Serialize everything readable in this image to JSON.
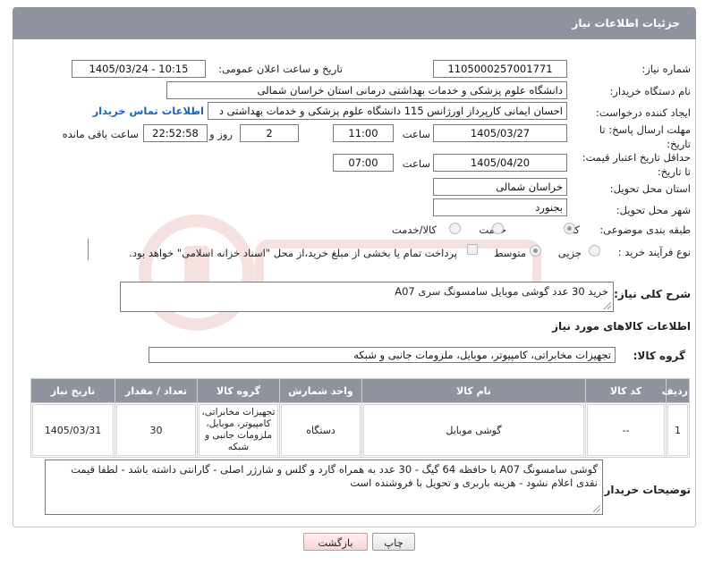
{
  "header": {
    "title": "جزئیات اطلاعات نیاز"
  },
  "form": {
    "need_number": {
      "label": "شماره نیاز:",
      "value": "1105000257001771"
    },
    "announce": {
      "label": "تاریخ و ساعت اعلان عمومی:",
      "value": "1405/03/24 - 10:15"
    },
    "buyer_org": {
      "label": "نام دستگاه خریدار:",
      "value": "دانشگاه علوم پزشکی و خدمات بهداشتی درمانی استان خراسان شمالی"
    },
    "requester": {
      "label": "ایجاد کننده درخواست:",
      "value": "احسان ایمانی کارپرداز اورژانس 115 دانشگاه علوم پزشکی و خدمات بهداشتی د",
      "contact_link": "اطلاعات تماس خریدار"
    },
    "deadline": {
      "label_line1": "مهلت ارسال پاسخ: تا",
      "label_line2": "تاریخ:",
      "date": "1405/03/27",
      "time_label": "ساعت",
      "time": "11:00",
      "days": "2",
      "days_label": "روز و",
      "remaining": "22:52:58",
      "remaining_label": "ساعت باقی مانده"
    },
    "price_validity": {
      "label_line1": "حداقل تاریخ اعتبار قیمت:",
      "label_line2": "تا تاریخ:",
      "date": "1405/04/20",
      "time_label": "ساعت",
      "time": "07:00"
    },
    "delivery_province": {
      "label": "استان محل تحویل:",
      "value": "خراسان شمالی"
    },
    "delivery_city": {
      "label": "شهر محل تحویل:",
      "value": "بجنورد"
    },
    "category": {
      "label": "طبقه بندی موضوعی:",
      "options": [
        "کالا",
        "خدمت",
        "کالا/خدمت"
      ],
      "selected": "کالا"
    },
    "purchase_type": {
      "label": "نوع فرآیند خرید :",
      "options": [
        "جزیی",
        "متوسط"
      ],
      "selected": "متوسط",
      "payment_note": "پرداخت تمام یا بخشی از مبلغ خرید،از محل \"اسناد خزانه اسلامی\" خواهد بود."
    }
  },
  "summary": {
    "label": "شرح کلی نیاز:",
    "value": "خرید 30 عدد گوشی موبایل سامسونگ سری A07"
  },
  "goods": {
    "section_title": "اطلاعات کالاهای مورد نیاز",
    "group_label": "گروه کالا:",
    "group_value": "تجهیزات مخابراتی، کامپیوتر، موبایل، ملزومات جانبی و شبکه",
    "columns": [
      "ردیف",
      "کد کالا",
      "نام کالا",
      "واحد شمارش",
      "گروه کالا",
      "تعداد / مقدار",
      "تاریخ نیاز"
    ],
    "rows": [
      {
        "row": "1",
        "code": "--",
        "name": "گوشی موبایل",
        "unit": "دستگاه",
        "group": "تجهیزات مخابراتی، کامپیوتر، موبایل، ملزومات جانبی و شبکه",
        "qty": "30",
        "date": "1405/03/31"
      }
    ]
  },
  "buyer_notes": {
    "label": "توضیحات خریدار:",
    "value": "گوشی سامسونگ A07 با حافظه 64 گیگ - 30 عدد به همراه گارد و گلس و شارژر اصلی - گارانتی داشته باشد - لطفا قیمت نقدی اعلام نشود - هزینه باربری و تحویل  با فروشنده است"
  },
  "buttons": {
    "print": "چاپ",
    "back": "بازگشت"
  },
  "colors": {
    "header_bg": "#8e939d",
    "link": "#1565c0",
    "watermark": "#c0392b"
  }
}
